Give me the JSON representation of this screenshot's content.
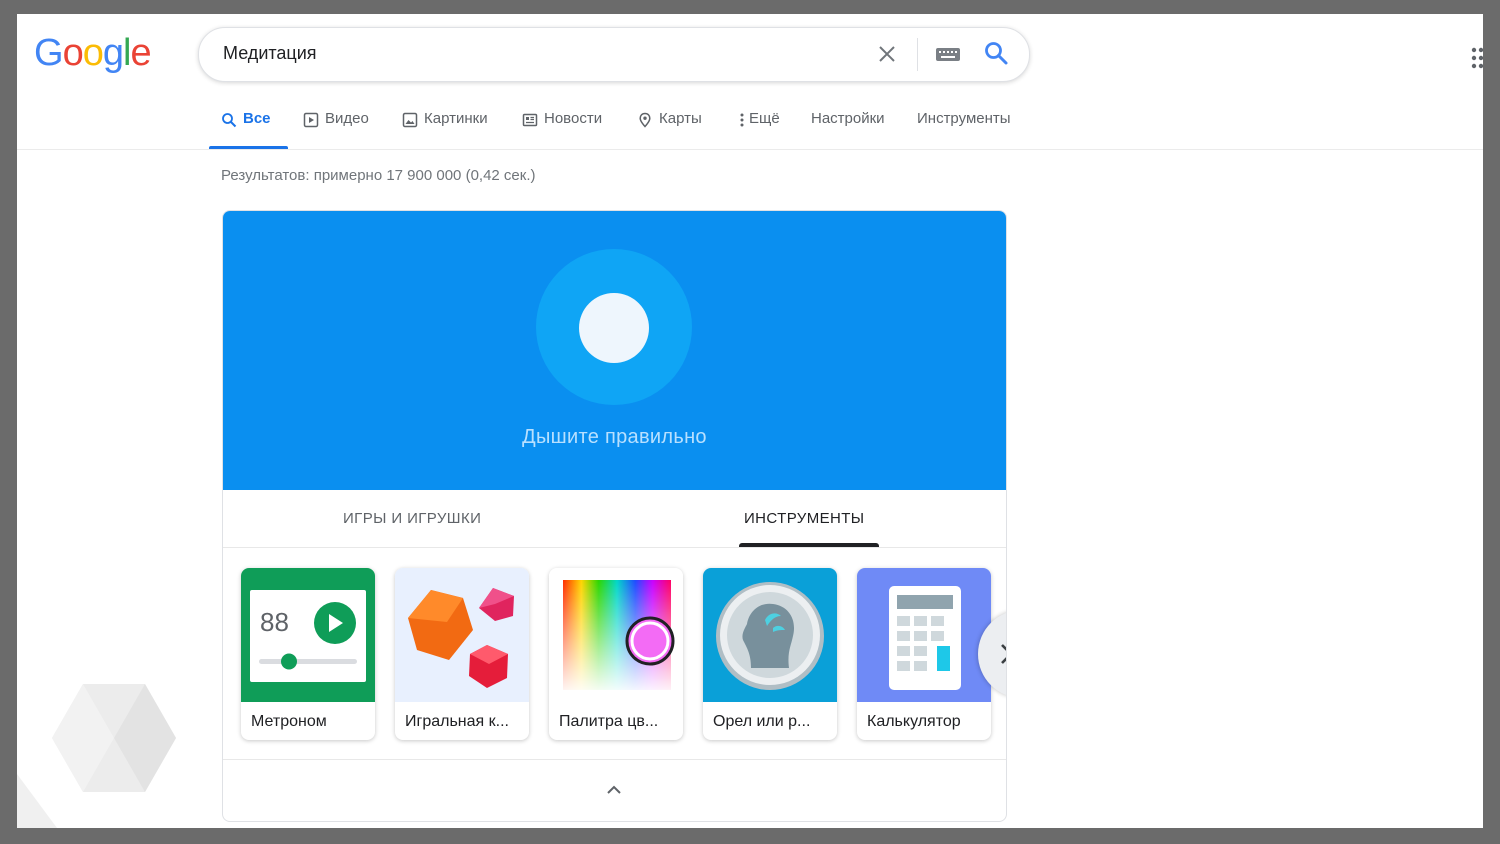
{
  "logo": {
    "letters": [
      "G",
      "o",
      "o",
      "g",
      "l",
      "e"
    ],
    "colors": [
      "#4285f4",
      "#ea4335",
      "#fbbc05",
      "#4285f4",
      "#34a853",
      "#ea4335"
    ]
  },
  "search": {
    "query": "Медитация"
  },
  "nav": {
    "tabs": [
      {
        "label": "Все",
        "icon": "search-icon",
        "active": true
      },
      {
        "label": "Видео",
        "icon": "video-icon"
      },
      {
        "label": "Картинки",
        "icon": "image-icon"
      },
      {
        "label": "Новости",
        "icon": "news-icon"
      },
      {
        "label": "Карты",
        "icon": "map-pin-icon"
      },
      {
        "label": "Ещё",
        "icon": "more-vert-icon"
      },
      {
        "label": "Настройки"
      },
      {
        "label": "Инструменты"
      }
    ]
  },
  "results": {
    "stats": "Результатов: примерно 17 900 000 (0,42 сек.)"
  },
  "breathing": {
    "label": "Дышите правильно",
    "color": "#0a8ff0"
  },
  "categories": [
    "ИГРЫ И ИГРУШКИ",
    "ИНСТРУМЕНТЫ"
  ],
  "metronome_value": "88",
  "tools": [
    {
      "label": "Метроном",
      "icon": "metronome-icon",
      "color": "#0f9d58"
    },
    {
      "label": "Игральная к...",
      "icon": "dice-icon",
      "color": "#e8f0fe"
    },
    {
      "label": "Палитра цв...",
      "icon": "color-palette-icon"
    },
    {
      "label": "Орел или р...",
      "icon": "coin-icon",
      "color": "#0aa0d8"
    },
    {
      "label": "Калькулятор",
      "icon": "calculator-icon",
      "color": "#6f8af6"
    }
  ]
}
